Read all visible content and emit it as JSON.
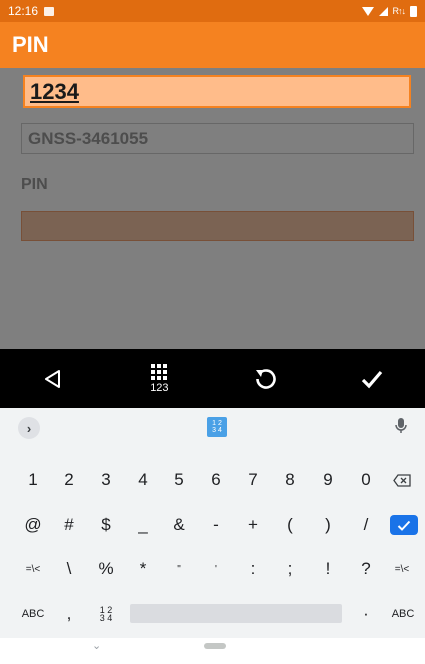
{
  "status_bar": {
    "time": "12:16",
    "data_indicator": "R↑↓"
  },
  "app_bar": {
    "title": "PIN"
  },
  "form": {
    "device_value": "GNSS-3461055",
    "pin_label": "PIN",
    "pin_field_value": ""
  },
  "edit_field": {
    "value": "1234"
  },
  "action_bar": {
    "numpad_label": "123"
  },
  "keyboard": {
    "mode_label_top": "1 2",
    "mode_label_bottom": "3 4",
    "row1": [
      "1",
      "2",
      "3",
      "4",
      "5",
      "6",
      "7",
      "8",
      "9",
      "0"
    ],
    "row2": [
      "@",
      "#",
      "$",
      "_",
      "&",
      "-",
      "+",
      "(",
      ")",
      "/"
    ],
    "row3": [
      "=\\<",
      "\\",
      "%",
      "*",
      "\"",
      "'",
      ":",
      ";",
      "!",
      "?",
      "=\\<"
    ],
    "row4": {
      "abc_left": "ABC",
      "comma": ",",
      "numpad_top": "1 2",
      "numpad_bottom": "3 4",
      "period": "·",
      "abc_right": "ABC"
    }
  },
  "colors": {
    "status_bar": "#e06c10",
    "app_bar": "#f58220",
    "edit_fill": "#ffbc8a",
    "enter_key": "#1a73e8"
  }
}
